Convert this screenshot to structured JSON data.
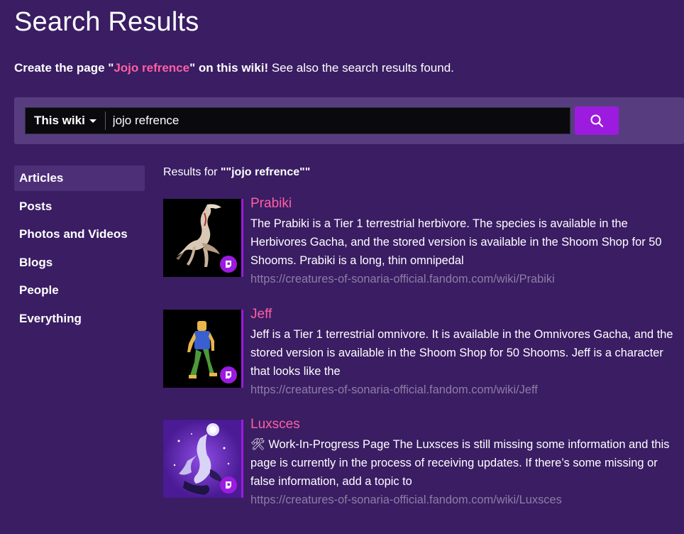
{
  "page": {
    "title": "Search Results"
  },
  "create_line": {
    "prefix": "Create the page \"",
    "page_name": "Jojo refrence",
    "suffix": "\" on this wiki!",
    "tail": " See also the search results found."
  },
  "search": {
    "scope_label": "This wiki",
    "query": "jojo refrence",
    "button_icon": "search-icon"
  },
  "sidebar": {
    "items": [
      {
        "label": "Articles",
        "active": true
      },
      {
        "label": "Posts",
        "active": false
      },
      {
        "label": "Photos and Videos",
        "active": false
      },
      {
        "label": "Blogs",
        "active": false
      },
      {
        "label": "People",
        "active": false
      },
      {
        "label": "Everything",
        "active": false
      }
    ]
  },
  "results_header": {
    "prefix": "Results for ",
    "query": "\"\"jojo refrence\"\""
  },
  "results": [
    {
      "title": "Prabiki",
      "snippet": "The Prabiki is a Tier 1 terrestrial herbivore. The species is available in the Herbivores Gacha, and the stored version is available in the Shoom Shop for 50 Shooms. Prabiki is a long, thin omnipedal",
      "url": "https://creatures-of-sonaria-official.fandom.com/wiki/Prabiki",
      "badge_icon": "fandom-logo-icon"
    },
    {
      "title": "Jeff",
      "snippet": "Jeff is a Tier 1 terrestrial omnivore. It is available in the Omnivores Gacha, and the stored version is available in the Shoom Shop for 50 Shooms. Jeff is a character that looks like the",
      "url": "https://creatures-of-sonaria-official.fandom.com/wiki/Jeff",
      "badge_icon": "fandom-logo-icon"
    },
    {
      "title": "Luxsces",
      "snippet": "🛠 Work-In-Progress Page The Luxsces is still missing some information and this page is currently in the process of receiving updates. If there’s some missing or false information, add a topic to",
      "url": "https://creatures-of-sonaria-official.fandom.com/wiki/Luxsces",
      "badge_icon": "fandom-logo-icon"
    }
  ],
  "colors": {
    "background": "#3a1d63",
    "accent_purple": "#9c1bdf",
    "link_pink": "#ff5fa2",
    "url_gray": "#8d7ea5"
  }
}
